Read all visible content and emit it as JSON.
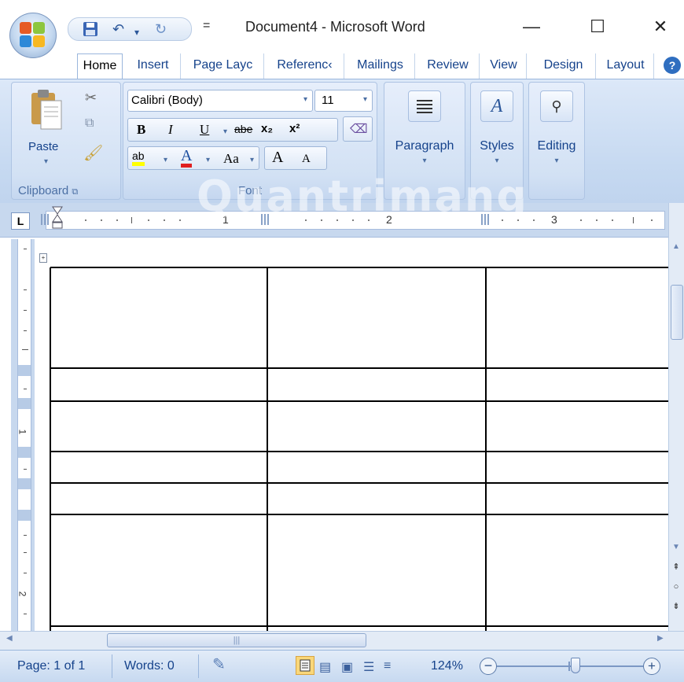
{
  "window": {
    "title": "Document4 - Microsoft Word",
    "controls": {
      "minimize": "—",
      "maximize": "☐",
      "close": "✕"
    }
  },
  "quick_access": {
    "save_icon": "save-icon",
    "undo_icon": "undo-icon",
    "redo_icon": "redo-icon",
    "customize": "="
  },
  "tabs": [
    {
      "label": "Home",
      "active": true
    },
    {
      "label": "Insert",
      "active": false
    },
    {
      "label": "Page Layc",
      "active": false
    },
    {
      "label": "Referenc‹",
      "active": false
    },
    {
      "label": "Mailings",
      "active": false
    },
    {
      "label": "Review",
      "active": false
    },
    {
      "label": "View",
      "active": false
    },
    {
      "label": "Design",
      "active": false
    },
    {
      "label": "Layout",
      "active": false
    }
  ],
  "ribbon": {
    "clipboard": {
      "paste": "Paste",
      "group_label": "Clipboard"
    },
    "font": {
      "font_name": "Calibri (Body)",
      "font_size": "11",
      "bold": "B",
      "italic": "I",
      "underline": "U",
      "strikethrough": "abe",
      "subscript": "x₂",
      "superscript": "x²",
      "highlight": "ab",
      "font_color": "A",
      "change_case": "Aa",
      "grow": "A",
      "shrink": "A",
      "group_label": "Font"
    },
    "paragraph": {
      "label": "Paragraph"
    },
    "styles": {
      "label": "Styles"
    },
    "editing": {
      "label": "Editing"
    }
  },
  "ruler": {
    "marks": [
      "1",
      "2",
      "3"
    ],
    "vmarks": [
      "1",
      "2"
    ]
  },
  "watermark": "Quantrimang",
  "table": {
    "rows": 6,
    "cols": 3
  },
  "status": {
    "page": "Page: 1 of 1",
    "words": "Words: 0",
    "zoom": "124%"
  },
  "colors": {
    "ribbon": "#c6d9f1",
    "accent": "#15428b",
    "grid": "#000000"
  }
}
